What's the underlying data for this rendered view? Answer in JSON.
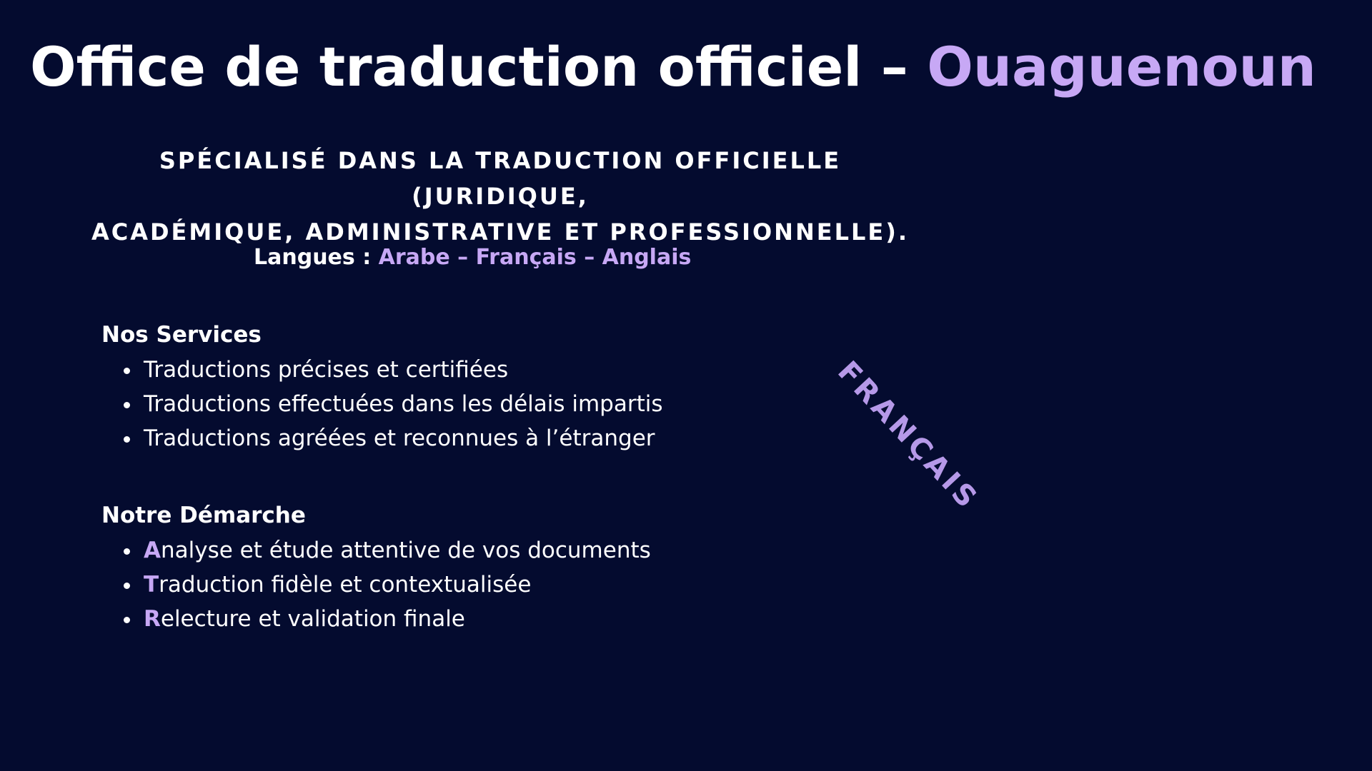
{
  "title": {
    "main": "Office de traduction officiel – ",
    "accent": "Ouaguenoun"
  },
  "subtitle": {
    "line1": "SPÉCIALISÉ DANS LA TRADUCTION OFFICIELLE (JURIDIQUE,",
    "line2": "ACADÉMIQUE, ADMINISTRATIVE ET PROFESSIONNELLE)."
  },
  "langues": {
    "label": "Langues : ",
    "values": "Arabe – Français – Anglais"
  },
  "services": {
    "heading": "Nos Services",
    "items": [
      "Traductions précises et certifiées",
      "Traductions effectuées dans les délais impartis",
      "Traductions agréées et reconnues à l’étranger"
    ]
  },
  "demarche": {
    "heading": "Notre Démarche",
    "items": [
      {
        "initial": "A",
        "rest": "nalyse et étude attentive de vos documents"
      },
      {
        "initial": "T",
        "rest": "raduction fidèle et contextualisée"
      },
      {
        "initial": "R",
        "rest": "electure et validation finale"
      }
    ]
  },
  "stamp": "FRANÇAIS",
  "colors": {
    "background": "#040b2f",
    "accent": "#c7a8f5",
    "text": "#ffffff"
  }
}
